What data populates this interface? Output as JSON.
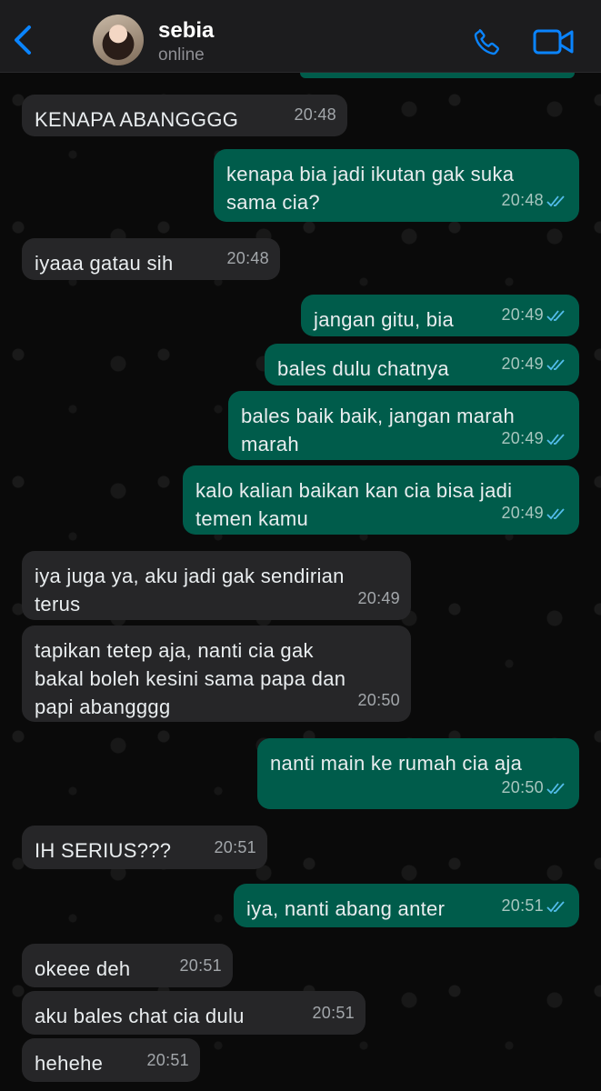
{
  "header": {
    "contact_name": "sebia",
    "status": "online"
  },
  "messages": [
    {
      "dir": "in",
      "text": "KENAPA ABANGGGG",
      "time": "20:48"
    },
    {
      "dir": "out",
      "text": "kenapa bia jadi ikutan gak suka\nsama cia?",
      "time": "20:48"
    },
    {
      "dir": "in",
      "text": "iyaaa gatau sih",
      "time": "20:48"
    },
    {
      "dir": "out",
      "text": "jangan gitu, bia",
      "time": "20:49"
    },
    {
      "dir": "out",
      "text": "bales dulu chatnya",
      "time": "20:49"
    },
    {
      "dir": "out",
      "text": "bales baik baik, jangan marah\nmarah",
      "time": "20:49"
    },
    {
      "dir": "out",
      "text": "kalo kalian baikan kan cia bisa jadi\ntemen kamu",
      "time": "20:49"
    },
    {
      "dir": "in",
      "text": "iya juga ya, aku jadi gak sendirian\nterus",
      "time": "20:49"
    },
    {
      "dir": "in",
      "text": "tapikan tetep aja, nanti cia gak\nbakal boleh kesini sama papa dan\npapi abangggg",
      "time": "20:50"
    },
    {
      "dir": "out",
      "text": "nanti main ke rumah cia aja",
      "time": "20:50"
    },
    {
      "dir": "in",
      "text": "IH SERIUS???",
      "time": "20:51"
    },
    {
      "dir": "out",
      "text": "iya, nanti abang anter",
      "time": "20:51"
    },
    {
      "dir": "in",
      "text": "okeee deh",
      "time": "20:51"
    },
    {
      "dir": "in",
      "text": "aku bales chat cia dulu",
      "time": "20:51"
    },
    {
      "dir": "in",
      "text": "hehehe",
      "time": "20:51"
    }
  ],
  "colors": {
    "accent": "#0a84ff",
    "outgoing_bubble": "#005c4b",
    "incoming_bubble": "#262628",
    "read_ticks": "#53bdeb"
  }
}
